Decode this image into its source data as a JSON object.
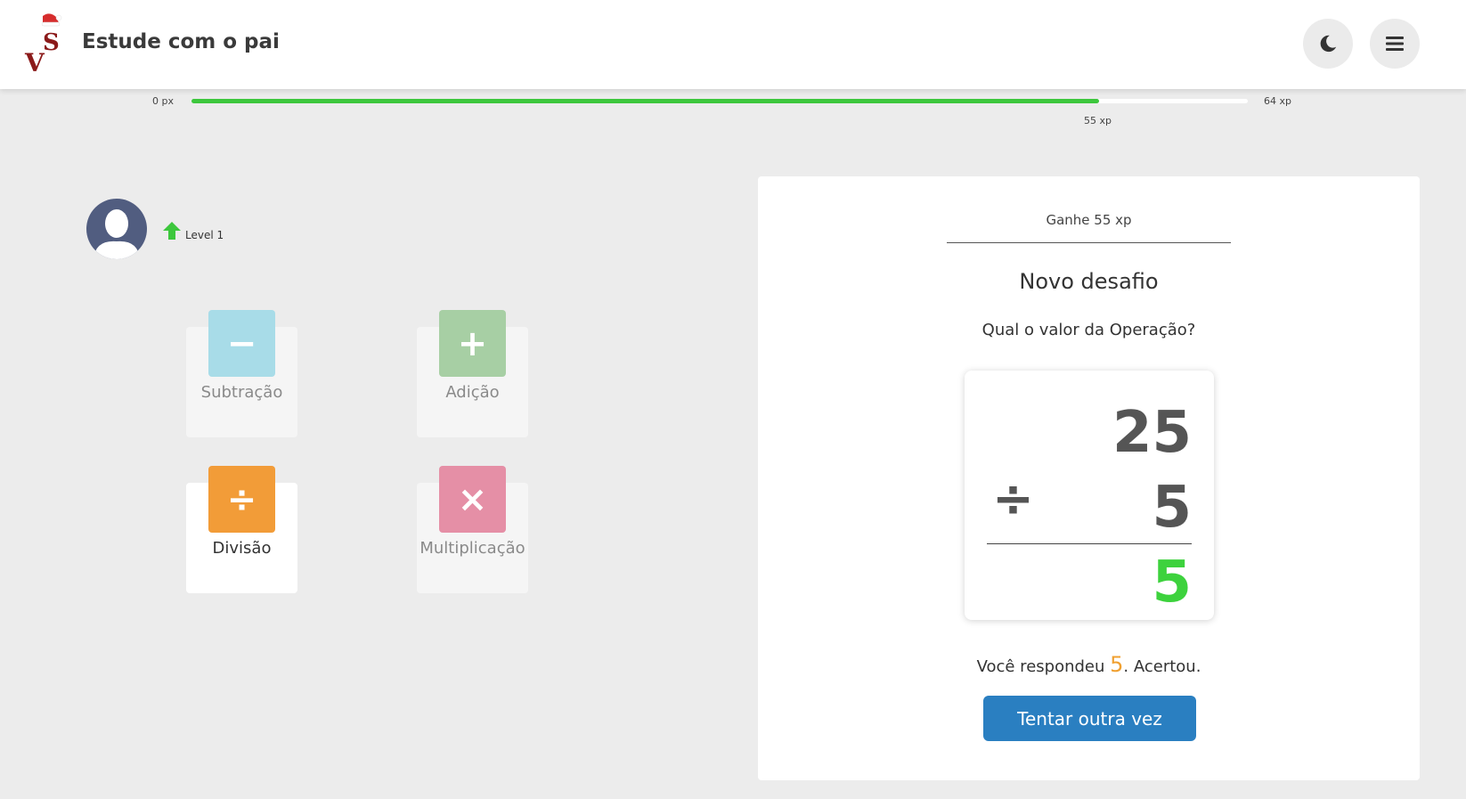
{
  "header": {
    "title": "Estude com o pai",
    "logo_icon": "vs-logo-icon",
    "theme_icon": "moon-icon",
    "menu_icon": "hamburger-menu-icon"
  },
  "xp_bar": {
    "min_label": "0 px",
    "max_label": "64 xp",
    "current_label": "55 xp",
    "progress_fraction": 0.859,
    "fill_color": "#3dc73d"
  },
  "profile": {
    "avatar_icon": "user-silhouette-icon",
    "level_icon": "arrow-up-icon",
    "level_label": "Level 1"
  },
  "operations": [
    {
      "label": "Subtração",
      "symbol": "−",
      "color": "#a8dce8",
      "icon": "minus-icon",
      "selected": false
    },
    {
      "label": "Adição",
      "symbol": "+",
      "color": "#a7cfa4",
      "icon": "plus-icon",
      "selected": false
    },
    {
      "label": "Divisão",
      "symbol": "÷",
      "color": "#f29c38",
      "icon": "divide-icon",
      "selected": true
    },
    {
      "label": "Multiplicação",
      "symbol": "×",
      "color": "#e58fa6",
      "icon": "multiply-icon",
      "selected": false
    }
  ],
  "challenge": {
    "earn_text": "Ganhe 55 xp",
    "title": "Novo desafio",
    "question": "Qual o valor da Operação?",
    "operand_a": "25",
    "operand_b": "5",
    "operator": "÷",
    "result": "5",
    "answer_prefix": "Você respondeu",
    "answer_value": "5",
    "answer_suffix": ". Acertou.",
    "retry_label": "Tentar outra vez"
  }
}
